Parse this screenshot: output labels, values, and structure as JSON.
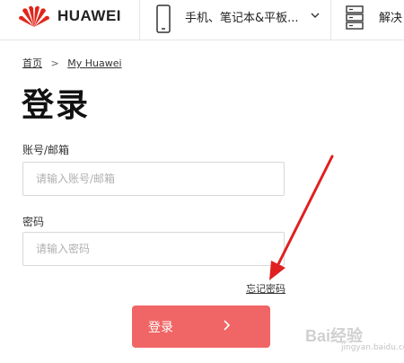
{
  "header": {
    "brand": "HUAWEI",
    "nav_products": "手机、笔记本&平板...",
    "nav_solutions": "解决"
  },
  "breadcrumb": {
    "home": "首页",
    "current": "My Huawei"
  },
  "page": {
    "title": "登录"
  },
  "form": {
    "account_label": "账号/邮箱",
    "account_placeholder": "请输入账号/邮箱",
    "password_label": "密码",
    "password_placeholder": "请输入密码",
    "forgot_password": "忘记密码",
    "login_button": "登录"
  },
  "watermark": {
    "text": "Bai经验",
    "sub": "jingyan.baidu.com"
  },
  "colors": {
    "brand_red": "#e1251b",
    "button": "#f06565",
    "annotation_arrow": "#e02020"
  },
  "icons": [
    "huawei-logo",
    "phone-icon",
    "chevron-down-icon",
    "server-icon",
    "chevron-right-icon",
    "arrow-right-icon"
  ]
}
